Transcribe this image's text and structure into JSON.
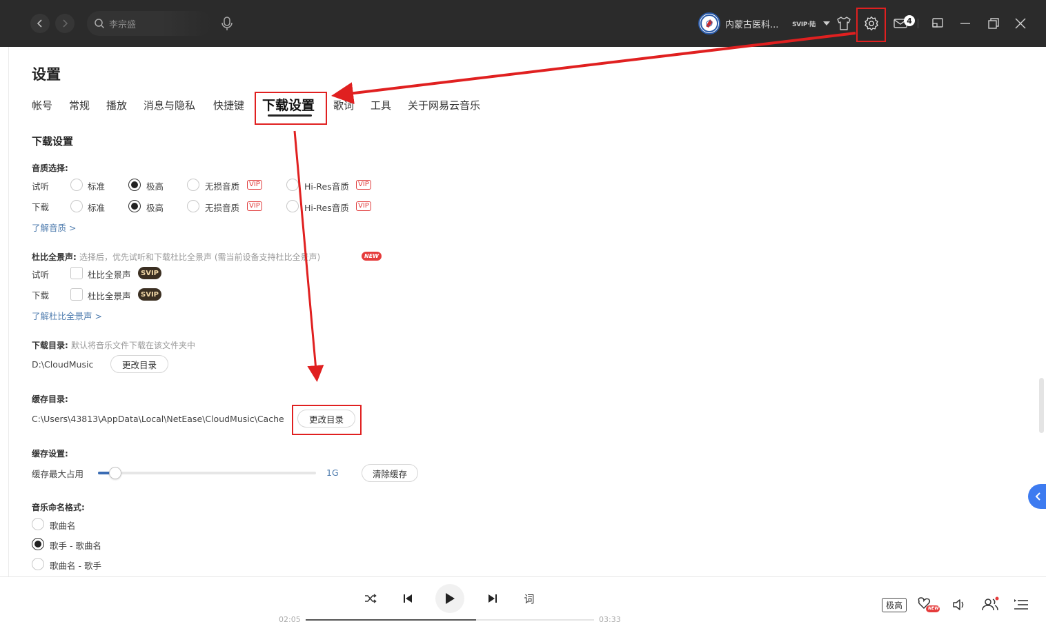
{
  "topbar": {
    "back_icon": "chevron-left-icon",
    "forward_icon": "chevron-right-icon",
    "search_text": "李宗盛",
    "user_name": "内蒙古医科...",
    "vip_label": "SVIP·陆",
    "mail_count": "4"
  },
  "page": {
    "title": "设置",
    "tabs": [
      {
        "label": "帐号"
      },
      {
        "label": "常规"
      },
      {
        "label": "播放"
      },
      {
        "label": "消息与隐私"
      },
      {
        "label": "快捷键"
      },
      {
        "label": "下载设置"
      },
      {
        "label": "歌词"
      },
      {
        "label": "工具"
      },
      {
        "label": "关于网易云音乐"
      }
    ],
    "active_tab": "下载设置"
  },
  "download": {
    "section_title": "下载设置",
    "quality": {
      "label": "音质选择:",
      "rows": [
        {
          "label": "试听",
          "selected": "极高"
        },
        {
          "label": "下载",
          "selected": "极高"
        }
      ],
      "options": [
        "标准",
        "极高",
        "无损音质",
        "Hi-Res音质"
      ],
      "vip_tag": "VIP",
      "link": "了解音质 >"
    },
    "dolby": {
      "label": "杜比全景声:",
      "hint": "选择后，优先试听和下载杜比全景声 (需当前设备支持杜比全景声)",
      "new_badge": "NEW",
      "rows": [
        {
          "label": "试听",
          "option": "杜比全景声",
          "checked": false
        },
        {
          "label": "下载",
          "option": "杜比全景声",
          "checked": false
        }
      ],
      "svip_tag": "SVIP",
      "link": "了解杜比全景声 >"
    },
    "download_dir": {
      "label": "下载目录:",
      "hint": "默认将音乐文件下载在该文件夹中",
      "path": "D:\\CloudMusic",
      "button": "更改目录"
    },
    "cache_dir": {
      "label": "缓存目录:",
      "path": "C:\\Users\\43813\\AppData\\Local\\NetEase\\CloudMusic\\Cache",
      "button": "更改目录"
    },
    "cache_settings": {
      "label": "缓存设置:",
      "slider_label": "缓存最大占用",
      "level": 0.08,
      "value_text": "1G",
      "clear_button": "清除缓存"
    },
    "naming": {
      "label": "音乐命名格式:",
      "options": [
        "歌曲名",
        "歌手 - 歌曲名",
        "歌曲名 - 歌手"
      ],
      "selected_index": 1
    }
  },
  "player": {
    "lyrics_label": "词",
    "current_time": "02:05",
    "total_time": "03:33",
    "progress": 0.59,
    "quality_label": "极高",
    "new_badge": "NEW"
  },
  "colors": {
    "topbar_bg": "#2b2b2b",
    "annotation_red": "#e02020",
    "link_blue": "#507daf",
    "vip_red": "#e03a3a"
  }
}
